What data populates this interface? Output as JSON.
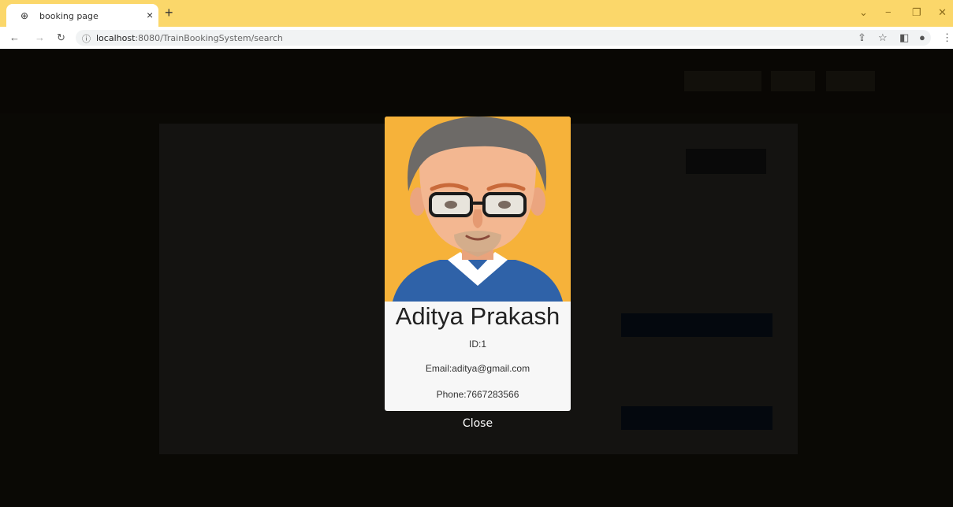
{
  "browser": {
    "tab_title": "booking page",
    "tab_close": "×",
    "new_tab": "+",
    "url_host": "localhost",
    "url_rest": ":8080/TrainBookingSystem/search",
    "controls": {
      "minimize": "−",
      "restore": "❐",
      "close": "✕",
      "dropdown": "⌄"
    }
  },
  "profile": {
    "name": "Aditya Prakash",
    "id_text": "ID:1",
    "email_text": "Email:aditya@gmail.com",
    "phone_text": "Phone:7667283566",
    "close_label": "Close",
    "avatar_bg": "#f6b23a"
  }
}
